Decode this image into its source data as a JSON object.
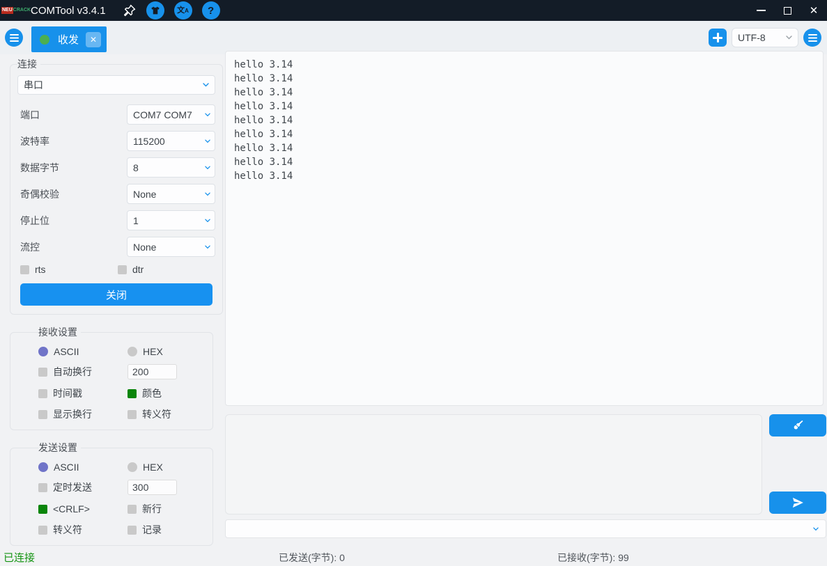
{
  "titlebar": {
    "logo_top": "NEU",
    "logo_bottom": "CRACK",
    "title": "COMTool v3.4.1",
    "translate_icon_text": "文",
    "translate_icon_sub": "A",
    "help_icon_text": "?"
  },
  "tabbar": {
    "active_tab_label": "收发",
    "encoding_value": "UTF-8"
  },
  "connection": {
    "legend": "连接",
    "type_value": "串口",
    "fields": [
      {
        "label": "端口",
        "value": "COM7 COM7"
      },
      {
        "label": "波特率",
        "value": "115200"
      },
      {
        "label": "数据字节",
        "value": "8"
      },
      {
        "label": "奇偶校验",
        "value": "None"
      },
      {
        "label": "停止位",
        "value": "1"
      },
      {
        "label": "流控",
        "value": "None"
      }
    ],
    "rts_label": "rts",
    "dtr_label": "dtr",
    "close_button": "关闭"
  },
  "receive_settings": {
    "legend": "接收设置",
    "ascii": "ASCII",
    "hex": "HEX",
    "auto_wrap": "自动换行",
    "auto_wrap_value": "200",
    "timestamp": "时间戳",
    "color": "颜色",
    "show_newline": "显示换行",
    "escape": "转义符"
  },
  "send_settings": {
    "legend": "发送设置",
    "ascii": "ASCII",
    "hex": "HEX",
    "timed_send": "定时发送",
    "timed_send_value": "300",
    "crlf": "<CRLF>",
    "newline": "新行",
    "escape": "转义符",
    "record": "记录"
  },
  "receive": {
    "lines": [
      "hello 3.14",
      "hello 3.14",
      "hello 3.14",
      "hello 3.14",
      "hello 3.14",
      "hello 3.14",
      "hello 3.14",
      "hello 3.14",
      "hello 3.14"
    ]
  },
  "statusbar": {
    "connection_status": "已连接",
    "sent_label": "已发送(字节):",
    "sent_value": "0",
    "received_label": "已接收(字节):",
    "received_value": "99"
  },
  "colors": {
    "accent_blue": "#1791eb",
    "titlebar_bg": "#131c27",
    "status_green": "#149412",
    "checked_green": "#0a850a",
    "radio_selected_purple": "#7074c8",
    "tab_dot_green": "#4caf50"
  }
}
